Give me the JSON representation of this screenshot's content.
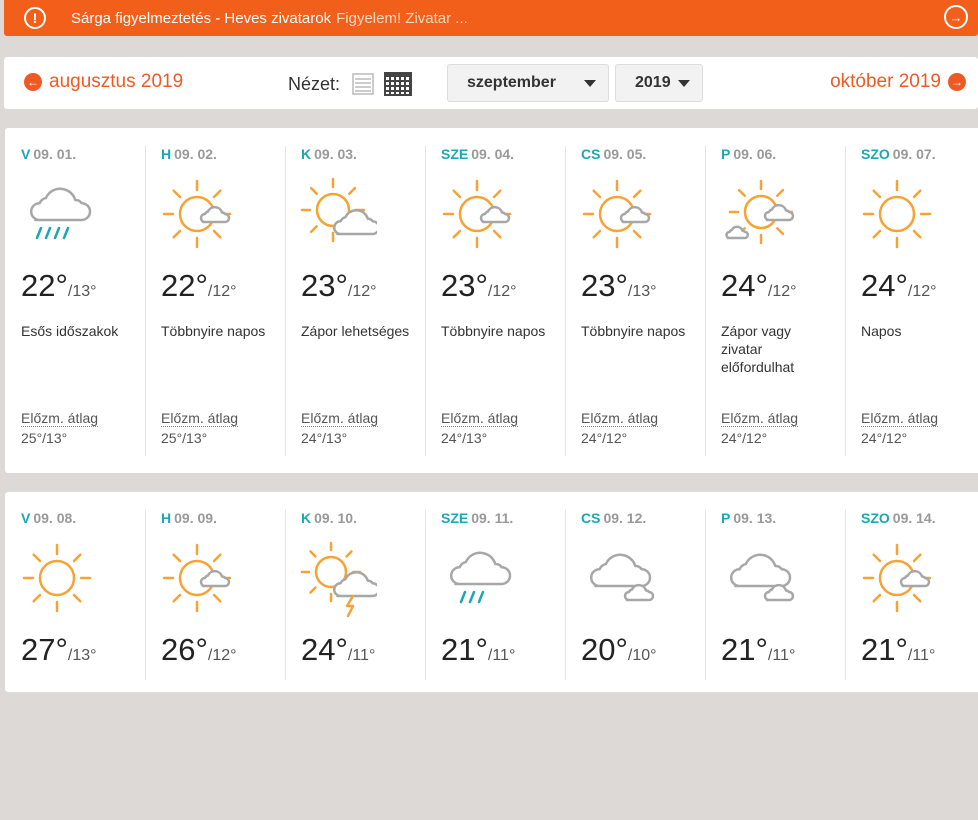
{
  "alert": {
    "title": "Sárga figyelmeztetés - Heves zivatarok",
    "rest": "Figyelem! Zivatar ..."
  },
  "nav": {
    "prev_label": "augusztus 2019",
    "next_label": "október 2019",
    "view_label": "Nézet:",
    "month_value": "szeptember",
    "year_value": "2019"
  },
  "hist_label": "Előzm. átlag",
  "weeks": [
    {
      "days": [
        {
          "dn": "V",
          "date": "09. 01.",
          "icon": "rain-cloud",
          "hi": "22°",
          "lo": "/13°",
          "desc": "Esős időszakok",
          "hist": "25°/13°"
        },
        {
          "dn": "H",
          "date": "09. 02.",
          "icon": "sun-small-cloud",
          "hi": "22°",
          "lo": "/12°",
          "desc": "Többnyire napos",
          "hist": "25°/13°"
        },
        {
          "dn": "K",
          "date": "09. 03.",
          "icon": "sun-cloud",
          "hi": "23°",
          "lo": "/12°",
          "desc": "Zápor lehetséges",
          "hist": "24°/13°"
        },
        {
          "dn": "SZE",
          "date": "09. 04.",
          "icon": "sun-small-cloud",
          "hi": "23°",
          "lo": "/12°",
          "desc": "Többnyire napos",
          "hist": "24°/13°"
        },
        {
          "dn": "CS",
          "date": "09. 05.",
          "icon": "sun-small-cloud",
          "hi": "23°",
          "lo": "/13°",
          "desc": "Többnyire napos",
          "hist": "24°/12°"
        },
        {
          "dn": "P",
          "date": "09. 06.",
          "icon": "sun-two-clouds",
          "hi": "24°",
          "lo": "/12°",
          "desc": "Zápor vagy zivatar előfordulhat",
          "hist": "24°/12°"
        },
        {
          "dn": "SZO",
          "date": "09. 07.",
          "icon": "sun",
          "hi": "24°",
          "lo": "/12°",
          "desc": "Napos",
          "hist": "24°/12°"
        }
      ]
    },
    {
      "days": [
        {
          "dn": "V",
          "date": "09. 08.",
          "icon": "sun",
          "hi": "27°",
          "lo": "/13°"
        },
        {
          "dn": "H",
          "date": "09. 09.",
          "icon": "sun-small-cloud",
          "hi": "26°",
          "lo": "/12°"
        },
        {
          "dn": "K",
          "date": "09. 10.",
          "icon": "sun-cloud-thunder",
          "hi": "24°",
          "lo": "/11°"
        },
        {
          "dn": "SZE",
          "date": "09. 11.",
          "icon": "rain-cloud-light",
          "hi": "21°",
          "lo": "/11°"
        },
        {
          "dn": "CS",
          "date": "09. 12.",
          "icon": "clouds",
          "hi": "20°",
          "lo": "/10°"
        },
        {
          "dn": "P",
          "date": "09. 13.",
          "icon": "clouds",
          "hi": "21°",
          "lo": "/11°"
        },
        {
          "dn": "SZO",
          "date": "09. 14.",
          "icon": "sun-small-cloud",
          "hi": "21°",
          "lo": "/11°"
        }
      ]
    }
  ],
  "colors": {
    "accent": "#ef5a24",
    "alert": "#f25f1a",
    "day_name": "#1aa7b6",
    "sun": "#f7a234",
    "cloud": "#a7a7a7",
    "rain": "#1aa7b6"
  }
}
